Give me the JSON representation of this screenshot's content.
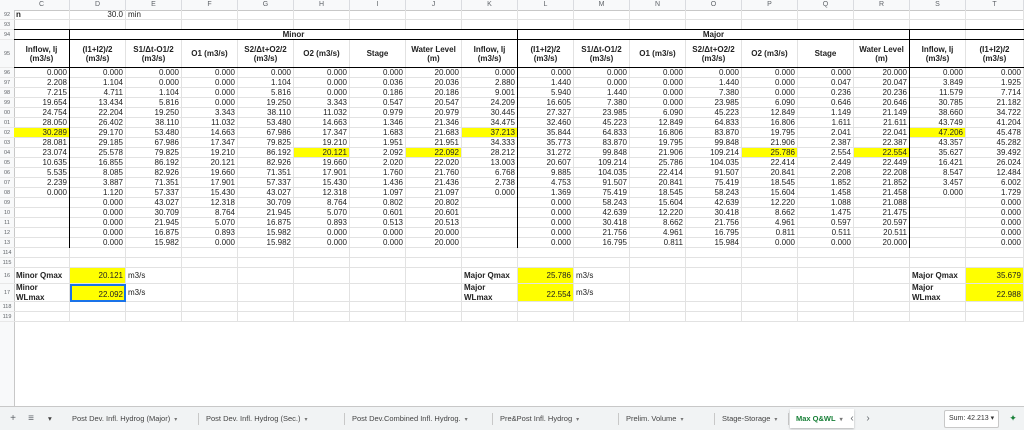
{
  "columns": [
    "C",
    "D",
    "E",
    "F",
    "G",
    "H",
    "I",
    "J",
    "K",
    "L",
    "M",
    "N",
    "O",
    "P",
    "Q",
    "R",
    "S",
    "T"
  ],
  "rows": {
    "r92": {
      "num": "92",
      "a": "n",
      "b": "30.0",
      "c": "min"
    },
    "blank_nums": [
      "93",
      "114",
      "115",
      "118",
      "119"
    ],
    "section_row": "94",
    "header_row": "95",
    "data_nums": [
      "96",
      "97",
      "98",
      "99",
      "00",
      "01",
      "02",
      "03",
      "04",
      "05",
      "06",
      "07",
      "08",
      "09",
      "10",
      "11",
      "12",
      "13"
    ],
    "summary_nums": [
      "16",
      "17"
    ]
  },
  "sections": {
    "minor": "Minor",
    "major": "Major"
  },
  "headers": {
    "minor": [
      "Inflow, Ij (m3/s)",
      "(I1+I2)/2 (m3/s)",
      "S1/Δt-O1/2 (m3/s)",
      "O1 (m3/s)",
      "S2/Δt+O2/2 (m3/s)",
      "O2 (m3/s)",
      "Stage",
      "Water Level (m)"
    ],
    "major": [
      "Inflow, Ij (m3/s)",
      "(I1+I2)/2 (m3/s)",
      "S1/Δt-O1/2 (m3/s)",
      "O1 (m3/s)",
      "S2/Δt+O2/2 (m3/s)",
      "O2 (m3/s)",
      "Stage",
      "Water Level (m)"
    ],
    "extra": [
      "Inflow, Ij (m3/s)",
      "(I1+I2)/2 (m3/s)"
    ]
  },
  "data": [
    [
      "0.000",
      "0.000",
      "0.000",
      "0.000",
      "0.000",
      "0.000",
      "0.000",
      "20.000",
      "0.000",
      "0.000",
      "0.000",
      "0.000",
      "0.000",
      "0.000",
      "0.000",
      "20.000",
      "0.000",
      "0.000"
    ],
    [
      "2.208",
      "1.104",
      "0.000",
      "0.000",
      "1.104",
      "0.000",
      "0.036",
      "20.036",
      "2.880",
      "1.440",
      "0.000",
      "0.000",
      "1.440",
      "0.000",
      "0.047",
      "20.047",
      "3.849",
      "1.925"
    ],
    [
      "7.215",
      "4.711",
      "1.104",
      "0.000",
      "5.816",
      "0.000",
      "0.186",
      "20.186",
      "9.001",
      "5.940",
      "1.440",
      "0.000",
      "7.380",
      "0.000",
      "0.236",
      "20.236",
      "11.579",
      "7.714"
    ],
    [
      "19.654",
      "13.434",
      "5.816",
      "0.000",
      "19.250",
      "3.343",
      "0.547",
      "20.547",
      "24.209",
      "16.605",
      "7.380",
      "0.000",
      "23.985",
      "6.090",
      "0.646",
      "20.646",
      "30.785",
      "21.182"
    ],
    [
      "24.754",
      "22.204",
      "19.250",
      "3.343",
      "38.110",
      "11.032",
      "0.979",
      "20.979",
      "30.445",
      "27.327",
      "23.985",
      "6.090",
      "45.223",
      "12.849",
      "1.149",
      "21.149",
      "38.660",
      "34.722"
    ],
    [
      "28.050",
      "26.402",
      "38.110",
      "11.032",
      "53.480",
      "14.663",
      "1.346",
      "21.346",
      "34.475",
      "32.460",
      "45.223",
      "12.849",
      "64.833",
      "16.806",
      "1.611",
      "21.611",
      "43.749",
      "41.204"
    ],
    [
      "30.289",
      "29.170",
      "53.480",
      "14.663",
      "67.986",
      "17.347",
      "1.683",
      "21.683",
      "37.213",
      "35.844",
      "64.833",
      "16.806",
      "83.870",
      "19.795",
      "2.041",
      "22.041",
      "47.206",
      "45.478"
    ],
    [
      "28.081",
      "29.185",
      "67.986",
      "17.347",
      "79.825",
      "19.210",
      "1.951",
      "21.951",
      "34.333",
      "35.773",
      "83.870",
      "19.795",
      "99.848",
      "21.906",
      "2.387",
      "22.387",
      "43.357",
      "45.282"
    ],
    [
      "23.074",
      "25.578",
      "79.825",
      "19.210",
      "86.192",
      "20.121",
      "2.092",
      "22.092",
      "28.212",
      "31.272",
      "99.848",
      "21.906",
      "109.214",
      "25.786",
      "2.554",
      "22.554",
      "35.627",
      "39.492"
    ],
    [
      "10.635",
      "16.855",
      "86.192",
      "20.121",
      "82.926",
      "19.660",
      "2.020",
      "22.020",
      "13.003",
      "20.607",
      "109.214",
      "25.786",
      "104.035",
      "22.414",
      "2.449",
      "22.449",
      "16.421",
      "26.024"
    ],
    [
      "5.535",
      "8.085",
      "82.926",
      "19.660",
      "71.351",
      "17.901",
      "1.760",
      "21.760",
      "6.768",
      "9.885",
      "104.035",
      "22.414",
      "91.507",
      "20.841",
      "2.208",
      "22.208",
      "8.547",
      "12.484"
    ],
    [
      "2.239",
      "3.887",
      "71.351",
      "17.901",
      "57.337",
      "15.430",
      "1.436",
      "21.436",
      "2.738",
      "4.753",
      "91.507",
      "20.841",
      "75.419",
      "18.545",
      "1.852",
      "21.852",
      "3.457",
      "6.002"
    ],
    [
      "0.000",
      "1.120",
      "57.337",
      "15.430",
      "43.027",
      "12.318",
      "1.097",
      "21.097",
      "0.000",
      "1.369",
      "75.419",
      "18.545",
      "58.243",
      "15.604",
      "1.458",
      "21.458",
      "0.000",
      "1.729"
    ],
    [
      "",
      "0.000",
      "43.027",
      "12.318",
      "30.709",
      "8.764",
      "0.802",
      "20.802",
      "",
      "0.000",
      "58.243",
      "15.604",
      "42.639",
      "12.220",
      "1.088",
      "21.088",
      "",
      "0.000"
    ],
    [
      "",
      "0.000",
      "30.709",
      "8.764",
      "21.945",
      "5.070",
      "0.601",
      "20.601",
      "",
      "0.000",
      "42.639",
      "12.220",
      "30.418",
      "8.662",
      "1.475",
      "21.475",
      "",
      "0.000"
    ],
    [
      "",
      "0.000",
      "21.945",
      "5.070",
      "16.875",
      "0.893",
      "0.513",
      "20.513",
      "",
      "0.000",
      "30.418",
      "8.662",
      "21.756",
      "4.961",
      "0.597",
      "20.597",
      "",
      "0.000"
    ],
    [
      "",
      "0.000",
      "16.875",
      "0.893",
      "15.982",
      "0.000",
      "0.000",
      "20.000",
      "",
      "0.000",
      "21.756",
      "4.961",
      "16.795",
      "0.811",
      "0.511",
      "20.511",
      "",
      "0.000"
    ],
    [
      "",
      "0.000",
      "15.982",
      "0.000",
      "15.982",
      "0.000",
      "0.000",
      "20.000",
      "",
      "0.000",
      "16.795",
      "0.811",
      "15.984",
      "0.000",
      "0.000",
      "20.000",
      "",
      "0.000"
    ]
  ],
  "highlights": [
    {
      "row": 6,
      "col": 0
    },
    {
      "row": 8,
      "col": 5
    },
    {
      "row": 8,
      "col": 7
    },
    {
      "row": 6,
      "col": 8
    },
    {
      "row": 8,
      "col": 13
    },
    {
      "row": 8,
      "col": 15
    },
    {
      "row": 6,
      "col": 16
    }
  ],
  "summary": {
    "minor": {
      "qlabel": "Minor Qmax",
      "qvalue": "20.121",
      "wlabel": "Minor WLmax",
      "wvalue": "22.092",
      "unit": "m3/s"
    },
    "major": {
      "qlabel": "Major Qmax",
      "qvalue": "25.786",
      "wlabel": "Major WLmax",
      "wvalue": "22.554",
      "unit": "m3/s"
    },
    "extra": {
      "qlabel": "Major Qmax",
      "qvalue": "35.679",
      "wlabel": "Major WLmax",
      "wvalue": "22.988"
    }
  },
  "tabs": [
    {
      "label": "Post Dev. Infl. Hydrog (Major)",
      "active": false
    },
    {
      "label": "Post Dev. Infl. Hydrog (Sec.)",
      "active": false
    },
    {
      "label": "Post Dev.Combined Infl. Hydrog.",
      "active": false
    },
    {
      "label": "Pre&Post Infl. Hydrog",
      "active": false
    },
    {
      "label": "Prelim. Volume",
      "active": false
    },
    {
      "label": "Stage-Storage",
      "active": false
    },
    {
      "label": "Max Q&WL",
      "active": true
    }
  ],
  "sum_label": "Sum: 42.213",
  "icons": {
    "add": "+",
    "menu": "≡",
    "prev": "‹",
    "next": "›",
    "explore": "✦",
    "caret": "▾"
  },
  "colors": {
    "highlight": "#ffff00",
    "active_tab": "#188038",
    "selection": "#1a73e8"
  }
}
